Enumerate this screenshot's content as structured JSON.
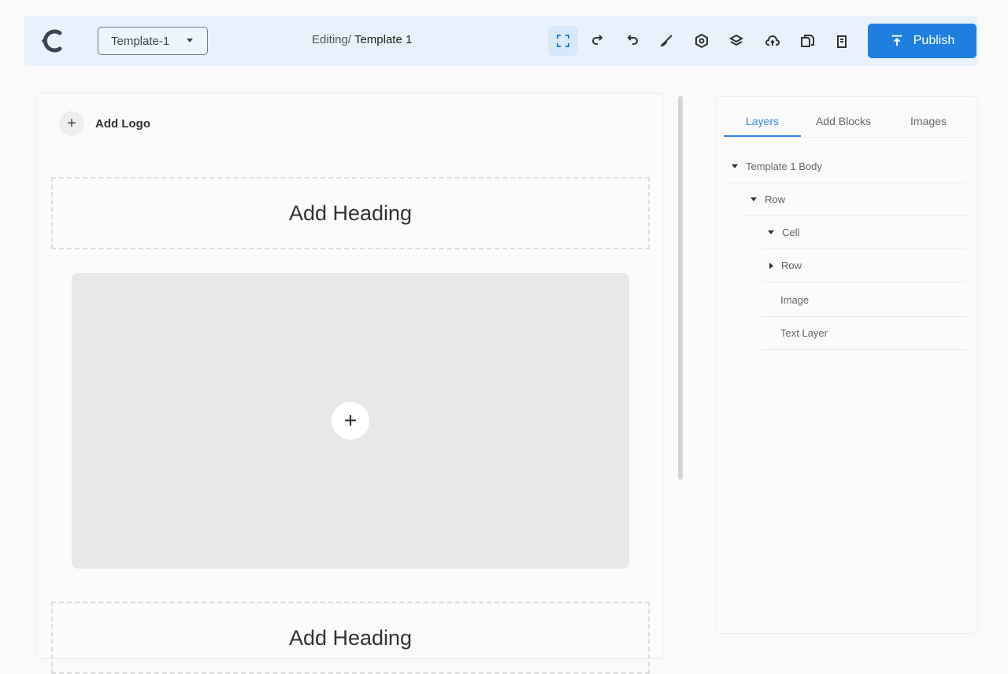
{
  "header": {
    "template_select": "Template-1",
    "editing_prefix": "Editing/ ",
    "editing_name": "Template 1",
    "publish_label": "Publish",
    "accent_color": "#1f7fe0",
    "tools": [
      "fullscreen-icon",
      "redo-icon",
      "undo-icon",
      "brush-icon",
      "settings-icon",
      "layers-icon",
      "cloud-upload-icon",
      "copy-icon",
      "delete-icon"
    ]
  },
  "canvas": {
    "add_logo_label": "Add Logo",
    "heading_1": "Add Heading",
    "heading_2": "Add Heading"
  },
  "panel": {
    "tabs": [
      "Layers",
      "Add Blocks",
      "Images"
    ],
    "active_tab": "Layers",
    "layers": [
      "Template 1 Body",
      "Row",
      "Cell",
      "Row",
      "Image",
      "Text Layer"
    ]
  }
}
